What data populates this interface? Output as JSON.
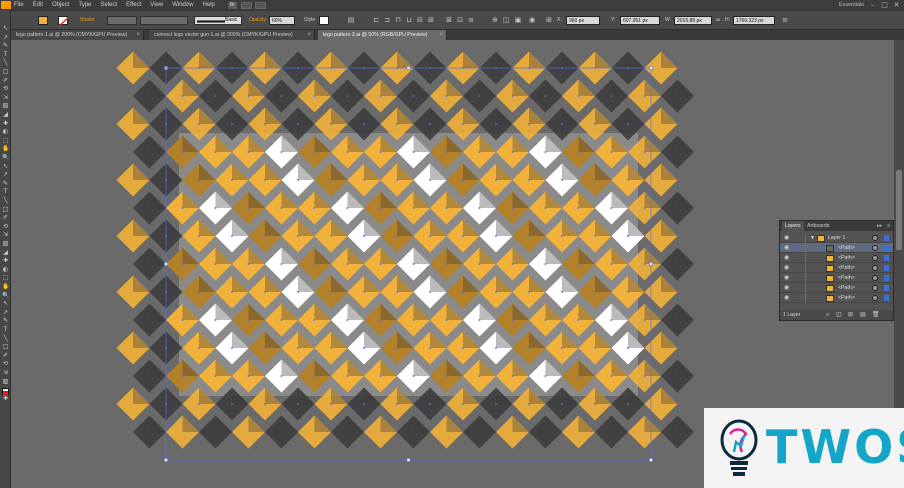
{
  "menubar": {
    "items": [
      "File",
      "Edit",
      "Object",
      "Type",
      "Select",
      "Effect",
      "View",
      "Window",
      "Help"
    ],
    "bridge": "Br",
    "workspace": "Essentials",
    "win_min": "–",
    "win_max": "□",
    "win_close": "✕"
  },
  "controlbar": {
    "stroke_label": "Stroke",
    "brush_value": "Basic",
    "opacity_label": "Opacity",
    "opacity_value": "60%",
    "style_label": "Style",
    "x_label": "X:",
    "x_value": "960 px",
    "y_label": "Y:",
    "y_value": "607.951 px",
    "w_label": "W:",
    "w_value": "2016.88 px",
    "h_label": "H:",
    "h_value": "1766.323 px"
  },
  "tabs": [
    {
      "label": "lego pattern 1.ai @ 200% (CMYK/GPU Preview)",
      "active": false
    },
    {
      "label": "connect lego vector gun 1.ai @ 300% (CMYK/GPU Preview)",
      "active": false
    },
    {
      "label": "lego pattern 2.ai @ 50% (RGB/GPU Preview)",
      "active": true
    }
  ],
  "layers_panel": {
    "tab_layers": "Layers",
    "tab_artboards": "Artboards",
    "layer_name": "Layer 1",
    "rows": [
      "<Path>",
      "<Path>",
      "<Path>",
      "<Path>",
      "<Path>",
      "<Path>"
    ],
    "footer": "1 Layer"
  },
  "watermark": {
    "brand": "TWOS",
    "brand_color": "#15a5c8"
  },
  "colors": {
    "pattern_orange": "#f2b13a",
    "pattern_dark_orange": "#b3812a",
    "pattern_white": "#ffffff",
    "pattern_dark": "#3d3d3d",
    "selection_blue": "#4f6fe6",
    "accent_orange": "#ff9a00"
  }
}
